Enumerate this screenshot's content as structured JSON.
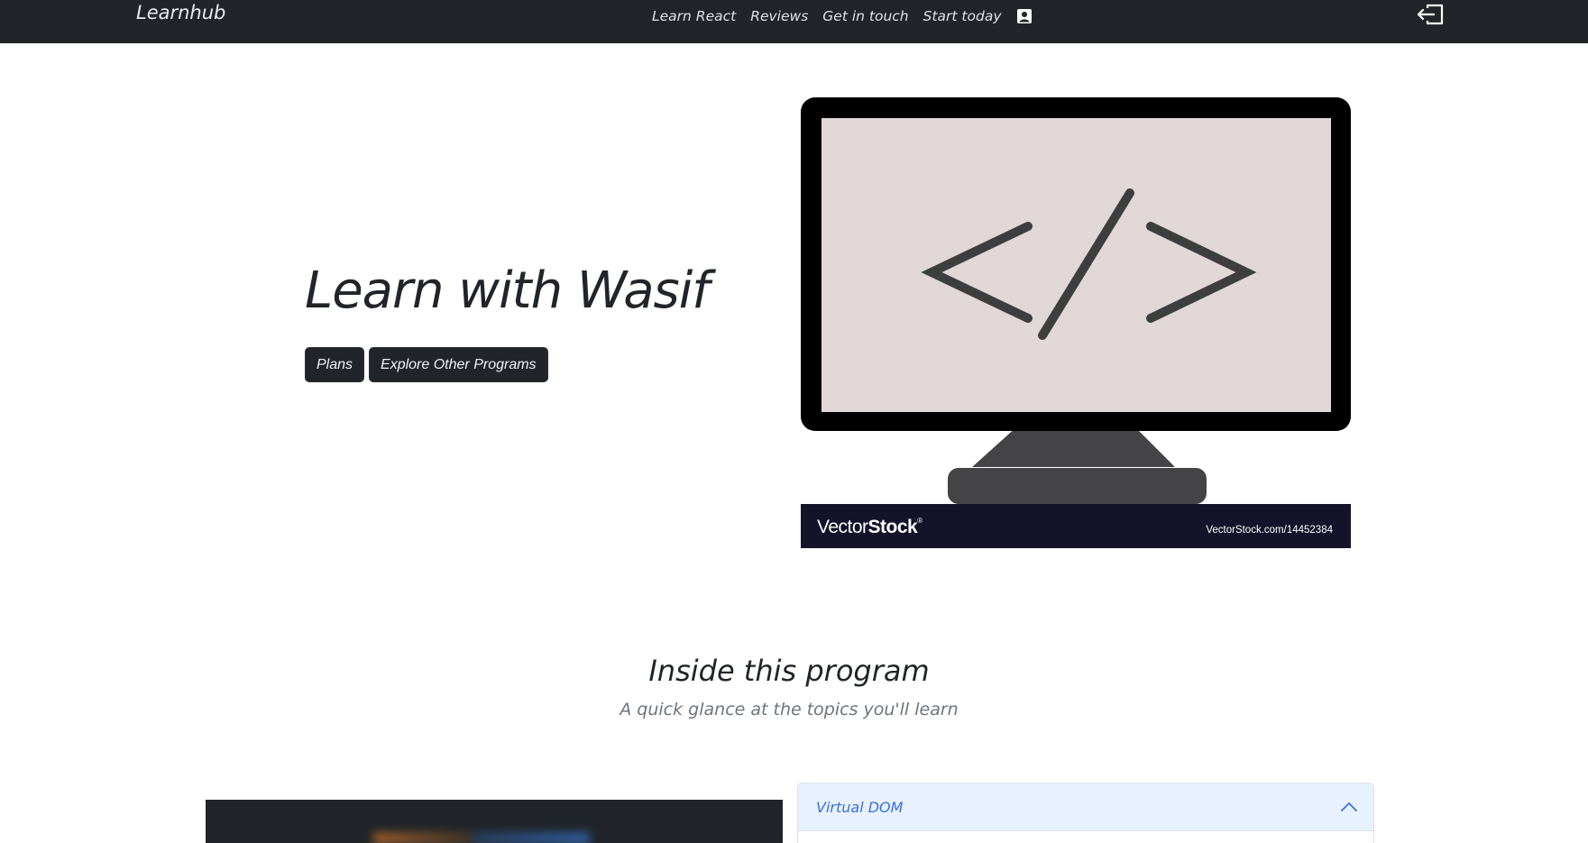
{
  "navbar": {
    "brand": "Learnhub",
    "links": [
      "Learn React",
      "Reviews",
      "Get in touch",
      "Start today"
    ],
    "icons": [
      "profile-icon",
      "logout-icon"
    ],
    "background": "#212529"
  },
  "hero": {
    "title": "Learn with Wasif",
    "buttons": [
      "Plans",
      "Explore Other Programs"
    ]
  },
  "illustration": {
    "watermark_brand_light": "Vector",
    "watermark_brand_bold": "Stock",
    "watermark_registered": "®",
    "watermark_url": "VectorStock.com/14452384",
    "code_symbol": "</>"
  },
  "program": {
    "title": "Inside this program",
    "subtitle": "A quick glance at the topics you'll learn"
  },
  "accordion": {
    "first_item": "Virtual DOM",
    "expanded": true,
    "header_color": "#e7f1ff",
    "title_color": "#3d6fd8"
  }
}
